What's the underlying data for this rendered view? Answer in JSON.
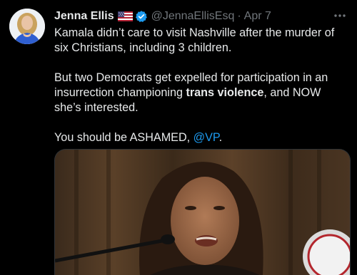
{
  "author": {
    "name": "Jenna Ellis",
    "handle": "@JennaEllisEsq",
    "separator": "·",
    "date": "Apr 7",
    "flag_icon": "us-flag-icon",
    "verified_icon": "verified-badge-icon"
  },
  "tweet": {
    "line1": "Kamala didn’t care to visit Nashville after the murder of six Christians, including 3 children.",
    "line2_pre": "But two Democrats get expelled for participation in an insurrection championing ",
    "line2_bold": "trans violence",
    "line2_post": ", and NOW she’s interested.",
    "line3_pre": "You should be ASHAMED, ",
    "line3_mention": "@VP",
    "line3_post": "."
  },
  "colors": {
    "background": "#000000",
    "text": "#e7e9ea",
    "muted": "#71767b",
    "link": "#1d9bf0"
  },
  "media": {
    "icon": "photo-kamala-harris"
  },
  "menu": {
    "icon": "more-options-icon"
  }
}
